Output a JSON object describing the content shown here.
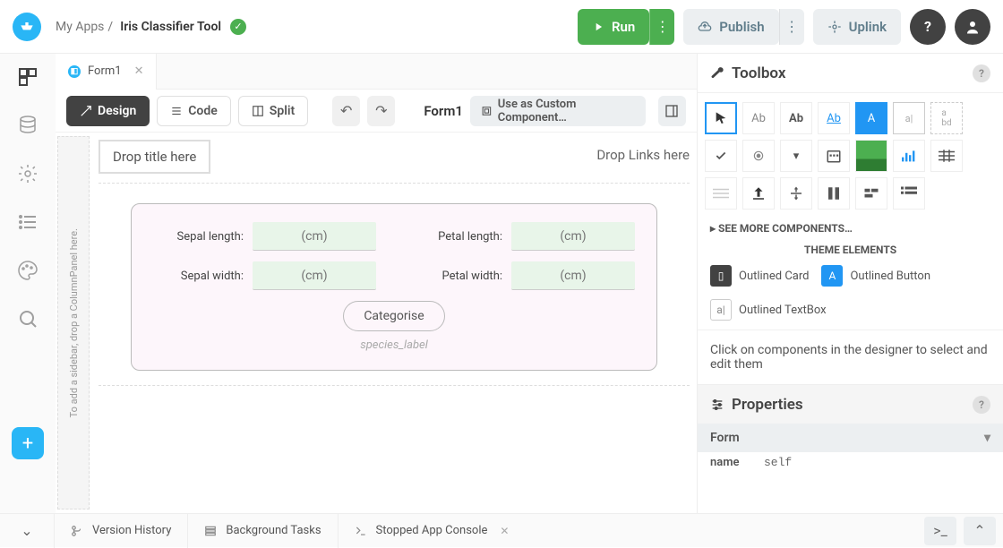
{
  "header": {
    "breadcrumb_root": "My Apps",
    "breadcrumb_sep": "/",
    "app_name": "Iris Classifier Tool",
    "run_label": "Run",
    "publish_label": "Publish",
    "uplink_label": "Uplink"
  },
  "tabs": {
    "form_tab": "Form1"
  },
  "toolbar": {
    "design": "Design",
    "code": "Code",
    "split": "Split",
    "form_name": "Form1",
    "custom_component": "Use as Custom Component…"
  },
  "canvas": {
    "drop_title": "Drop title here",
    "drop_links": "Drop Links here",
    "sidebar_hint": "To add a sidebar, drop a ColumnPanel here.",
    "sepal_length_label": "Sepal length:",
    "sepal_width_label": "Sepal width:",
    "petal_length_label": "Petal length:",
    "petal_width_label": "Petal width:",
    "cm_placeholder": "(cm)",
    "categorise_btn": "Categorise",
    "species_label": "species_label"
  },
  "toolbox": {
    "title": "Toolbox",
    "see_more": "SEE MORE COMPONENTS…",
    "theme_title": "THEME ELEMENTS",
    "outlined_card": "Outlined Card",
    "outlined_button": "Outlined Button",
    "outlined_textbox": "Outlined TextBox",
    "hint": "Click on components in the designer to select and edit them"
  },
  "properties": {
    "title": "Properties",
    "section": "Form",
    "name_label": "name",
    "name_value": "self"
  },
  "bottom": {
    "version_history": "Version History",
    "background_tasks": "Background Tasks",
    "console": "Stopped App Console"
  }
}
